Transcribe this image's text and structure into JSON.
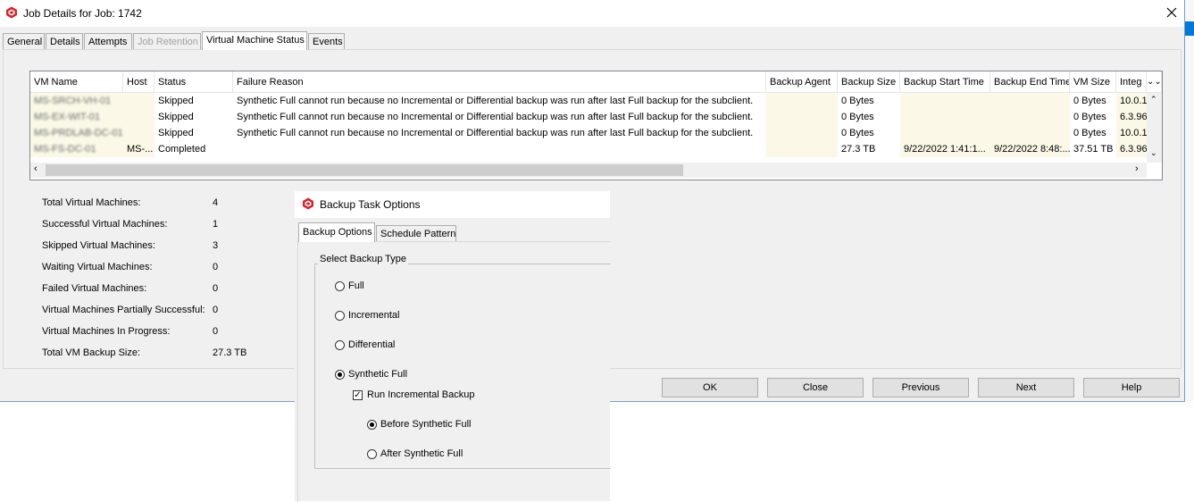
{
  "window": {
    "title": "Job Details for Job: 1742"
  },
  "tabs": [
    {
      "label": "General"
    },
    {
      "label": "Details"
    },
    {
      "label": "Attempts"
    },
    {
      "label": "Job Retention"
    },
    {
      "label": "Virtual Machine Status"
    },
    {
      "label": "Events"
    }
  ],
  "table": {
    "columns": [
      "VM Name",
      "Host",
      "Status",
      "Failure Reason",
      "Backup Agent",
      "Backup Size",
      "Backup Start Time",
      "Backup End Time",
      "VM Size",
      "Integ"
    ],
    "rows": [
      {
        "vm_name": "MS-SRCH-VH-01",
        "host": "",
        "status": "Skipped",
        "reason": "Synthetic Full cannot run because no Incremental or Differential backup was run after last Full backup for the subclient.",
        "agent": "",
        "size": "0 Bytes",
        "start": "",
        "end": "",
        "vmsize": "0 Bytes",
        "integ": "10.0.1"
      },
      {
        "vm_name": "MS-EX-WIT-01",
        "host": "",
        "status": "Skipped",
        "reason": "Synthetic Full cannot run because no Incremental or Differential backup was run after last Full backup for the subclient.",
        "agent": "",
        "size": "0 Bytes",
        "start": "",
        "end": "",
        "vmsize": "0 Bytes",
        "integ": "6.3.96"
      },
      {
        "vm_name": "MS-PRDLAB-DC-01",
        "host": "",
        "status": "Skipped",
        "reason": "Synthetic Full cannot run because no Incremental or Differential backup was run after last Full backup for the subclient.",
        "agent": "",
        "size": "0 Bytes",
        "start": "",
        "end": "",
        "vmsize": "0 Bytes",
        "integ": "10.0.1"
      },
      {
        "vm_name": "MS-FS-DC-01",
        "host": "MS-...",
        "status": "Completed",
        "reason": "",
        "agent": "",
        "size": "27.3 TB",
        "start": "9/22/2022 1:41:1...",
        "end": "9/22/2022 8:48:...",
        "vmsize": "37.51 TB",
        "integ": "6.3.96"
      }
    ]
  },
  "summary": [
    {
      "label": "Total Virtual Machines:",
      "value": "4"
    },
    {
      "label": "Successful Virtual Machines:",
      "value": "1"
    },
    {
      "label": "Skipped Virtual Machines:",
      "value": "3"
    },
    {
      "label": "Waiting Virtual Machines:",
      "value": "0"
    },
    {
      "label": "Failed Virtual Machines:",
      "value": "0"
    },
    {
      "label": "Virtual Machines Partially Successful:",
      "value": "0"
    },
    {
      "label": "Virtual Machines In Progress:",
      "value": "0"
    },
    {
      "label": "Total VM Backup Size:",
      "value": "27.3 TB"
    }
  ],
  "buttons": {
    "ok": "OK",
    "close": "Close",
    "previous": "Previous",
    "next": "Next",
    "help": "Help"
  },
  "dialog": {
    "title": "Backup Task Options",
    "tabs": [
      "Backup Options",
      "Schedule Pattern"
    ],
    "group_label": "Select Backup Type",
    "options": {
      "full": "Full",
      "incremental": "Incremental",
      "differential": "Differential",
      "synthetic_full": "Synthetic Full"
    },
    "selected": "synthetic_full",
    "run_incremental": {
      "label": "Run Incremental Backup",
      "checked": true
    },
    "before_synth": "Before Synthetic Full",
    "after_synth": "After Synthetic Full",
    "timing_selected": "before"
  },
  "icons": {
    "app": "commvault-logo-icon",
    "close": "close-icon"
  },
  "colors": {
    "logo": "#d9222a",
    "accent_edge": "#0078d7",
    "row_alt": "#fbf8e7"
  }
}
